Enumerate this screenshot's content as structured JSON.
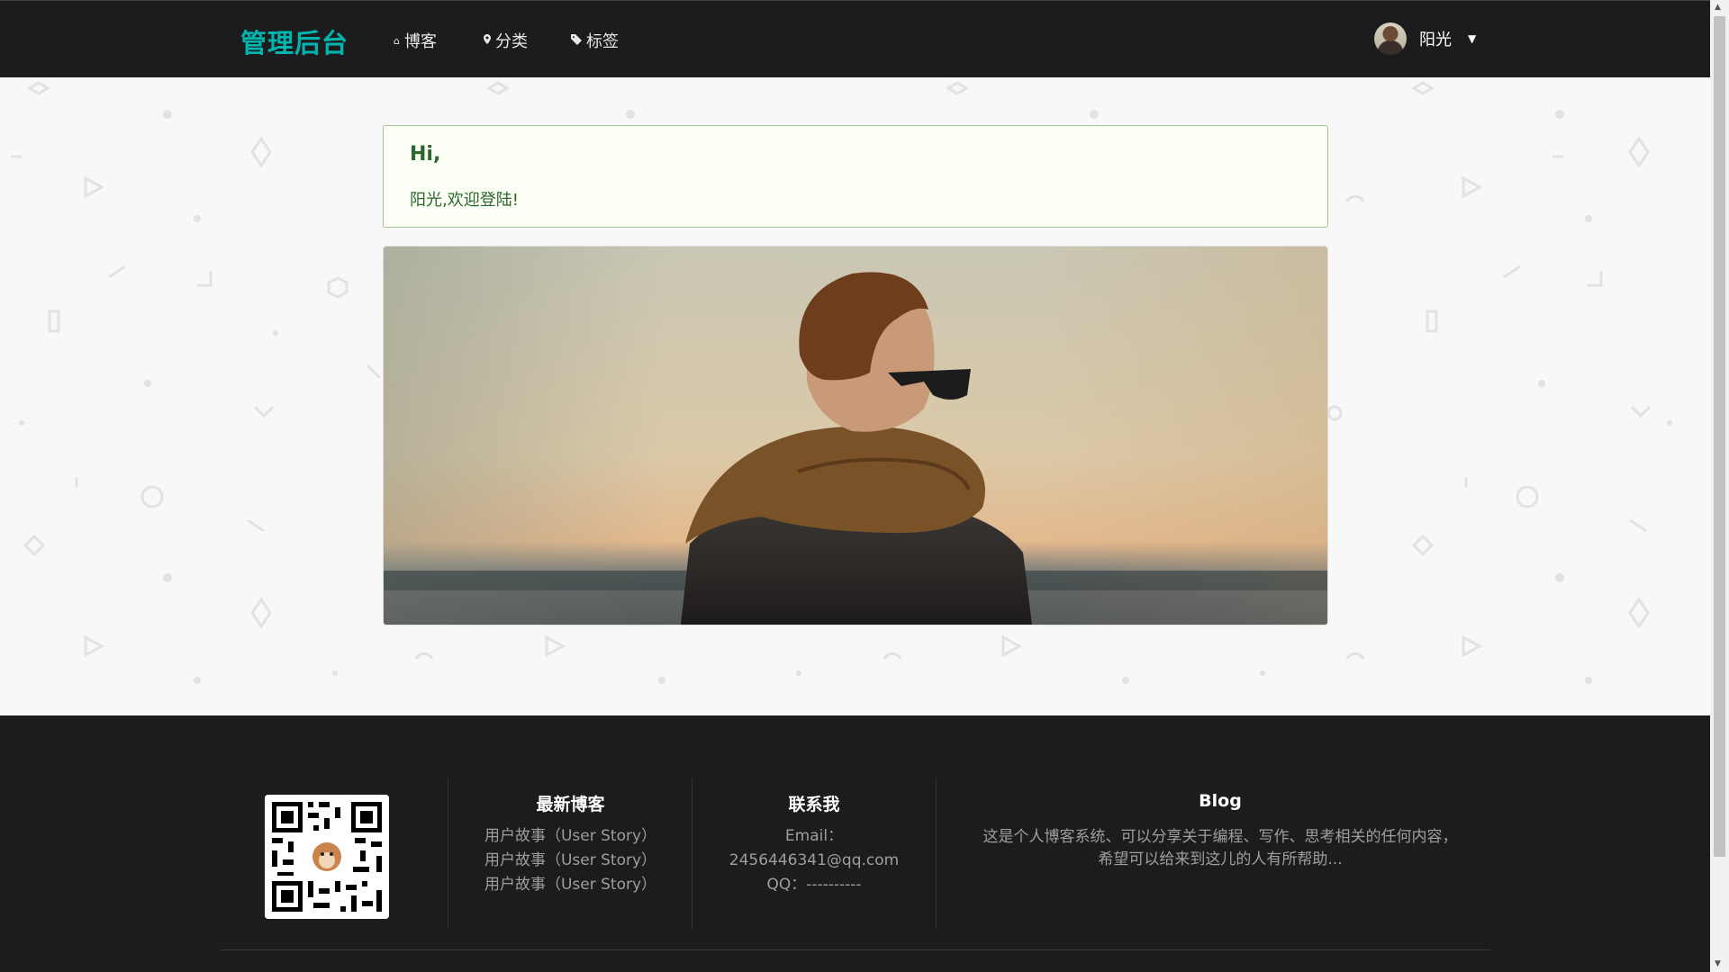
{
  "nav": {
    "brand": "管理后台",
    "items": [
      {
        "icon": "home-icon",
        "label": "博客"
      },
      {
        "icon": "map-pin-icon",
        "label": "分类"
      },
      {
        "icon": "tag-icon",
        "label": "标签"
      }
    ],
    "user_name": "阳光"
  },
  "greeting": {
    "title": "Hi,",
    "message": "阳光,欢迎登陆!"
  },
  "footer": {
    "latest_title": "最新博客",
    "latest_items": [
      "用户故事（User Story）",
      "用户故事（User Story）",
      "用户故事（User Story）"
    ],
    "contact_title": "联系我",
    "email": "Email：2456446341@qq.com",
    "qq": "QQ：----------",
    "blog_title": "Blog",
    "blog_desc_line1": "这是个人博客系统、可以分享关于编程、写作、思考相关的任何内容，",
    "blog_desc_line2": "希望可以给来到这儿的人有所帮助..."
  },
  "colors": {
    "brand": "#00b5ad",
    "nav_bg": "#1b1c1d",
    "greeting_text": "#2c662d",
    "greeting_bg": "#fcfff5"
  }
}
